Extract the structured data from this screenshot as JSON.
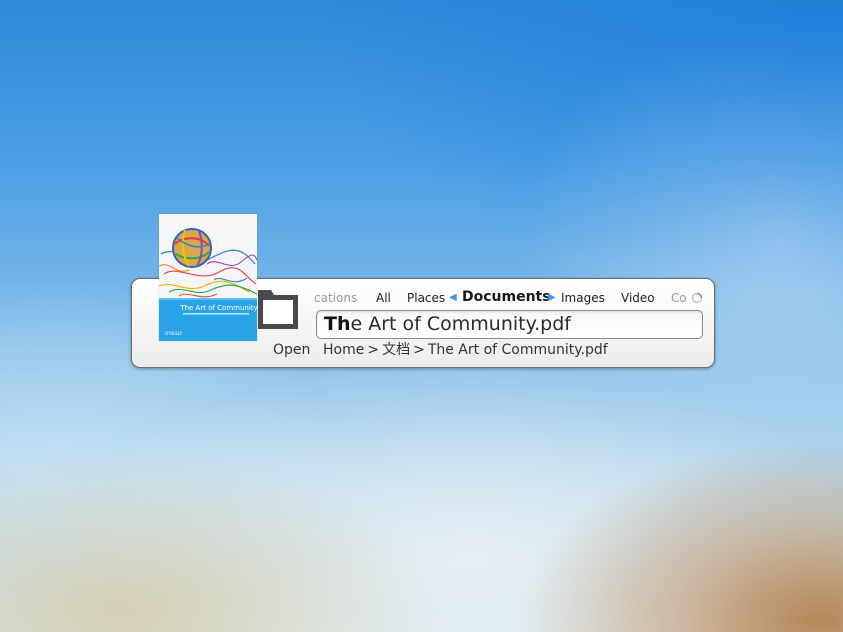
{
  "runner": {
    "categories": {
      "faded_left": "cations",
      "all": "All",
      "places": "Places",
      "active": "Documents",
      "images": "Images",
      "video": "Video",
      "faded_right": "Co"
    },
    "query": {
      "matched": "Th",
      "rest": "e Art of Community.pdf"
    },
    "result": {
      "action": "Open",
      "path": [
        "Home",
        "文档",
        "The Art of Community.pdf"
      ],
      "separator": ">",
      "thumbnail": {
        "title": "The Art of Community",
        "publisher": "O'REILLY"
      }
    }
  },
  "colors": {
    "accent_arrow": "#3d9ae8",
    "cover_band": "#29a4e6"
  },
  "icons": {
    "folder": "folder-icon",
    "busy": "busy-indicator-icon",
    "prev": "arrow-left-icon",
    "next": "arrow-right-icon"
  }
}
